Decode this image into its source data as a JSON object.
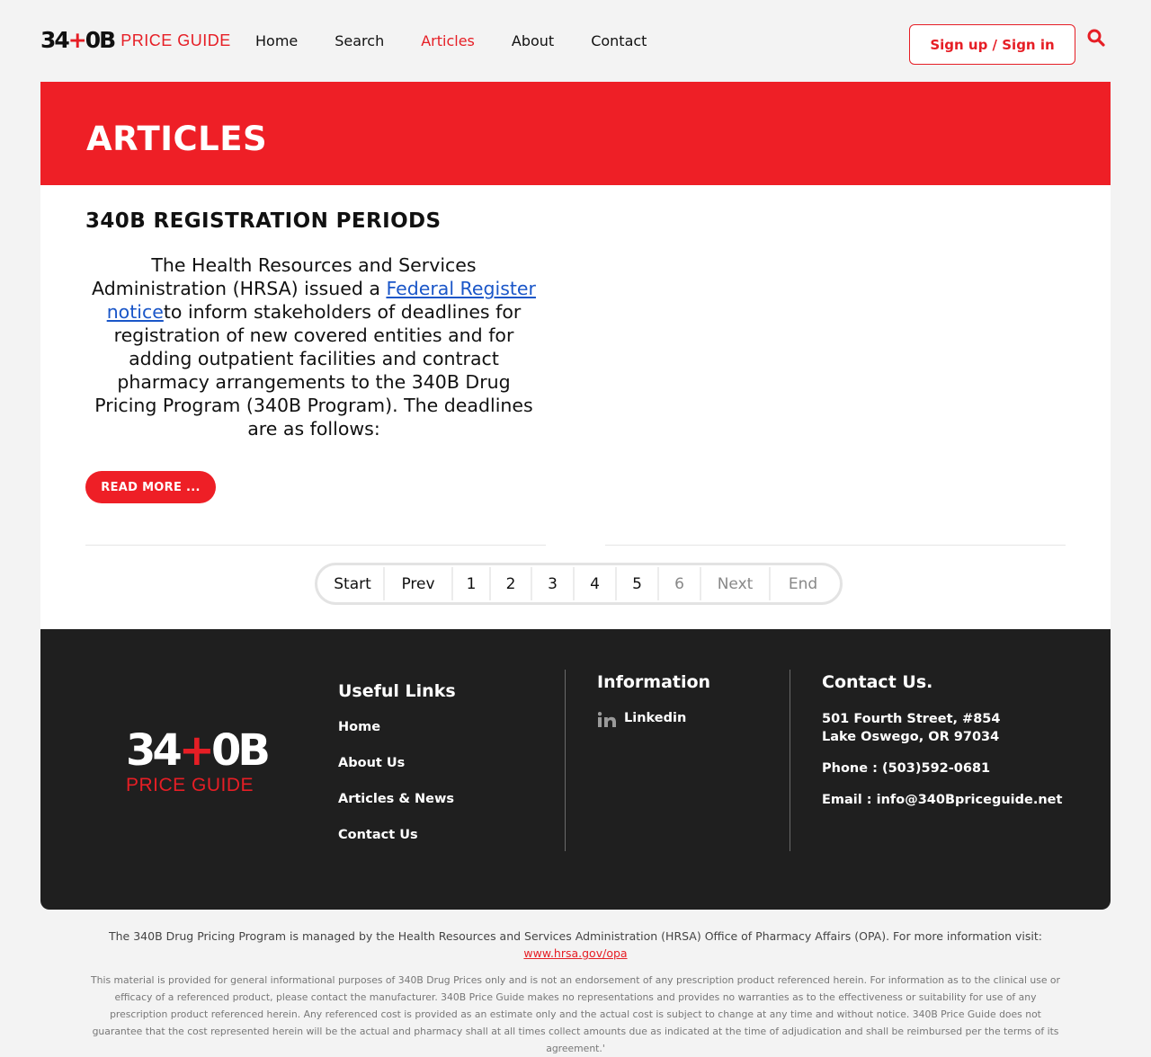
{
  "header": {
    "logo_mark_a": "34",
    "logo_mark_cross": "+",
    "logo_mark_b": "0B",
    "logo_text": "PRICE GUIDE",
    "nav": [
      "Home",
      "Search",
      "Articles",
      "About",
      "Contact"
    ],
    "active_nav": "Articles",
    "signin_label": "Sign up / Sign in",
    "accent_color": "#ee1f26"
  },
  "hero": {
    "title": "ARTICLES"
  },
  "article": {
    "title": "340B REGISTRATION PERIODS",
    "body_before_link": "The Health Resources and Services Administration (HRSA) issued a ",
    "link_text": "Federal Register notice",
    "body_after_link": "to inform stakeholders of deadlines for registration of new covered entities and for adding outpatient facilities and contract pharmacy arrangements to the 340B Drug Pricing Program (340B Program). The deadlines are as follows:",
    "read_more_label": "READ MORE ..."
  },
  "pagination": {
    "items": [
      "Start",
      "Prev",
      "1",
      "2",
      "3",
      "4",
      "5",
      "6",
      "Next",
      "End"
    ],
    "current": "6"
  },
  "footer": {
    "logo_mark_a": "34",
    "logo_mark_cross": "+",
    "logo_mark_b": "0B",
    "logo_text": "PRICE GUIDE",
    "useful_links_title": "Useful Links",
    "useful_links": [
      "Home",
      "About Us",
      "Articles & News",
      "Contact Us"
    ],
    "information_title": "Information",
    "linkedin_label": "Linkedin",
    "contact_title": "Contact Us.",
    "address_line1": "501 Fourth Street, #854",
    "address_line2": "Lake Oswego, OR 97034",
    "phone": "Phone : (503)592-0681",
    "email": "Email : info@340Bpriceguide.net"
  },
  "bottom": {
    "program_note": "The 340B Drug Pricing Program is managed by the Health Resources and Services Administration (HRSA) Office of Pharmacy Affairs (OPA). For more information visit:",
    "program_link": "www.hrsa.gov/opa",
    "disclaimer": "This material is provided for general informational purposes of 340B Drug Prices only and is not an endorsement of any prescription product referenced herein. For information as to the clinical use or efficacy of a referenced product, please contact the manufacturer. 340B Price Guide makes no representations and provides no warranties as to the effectiveness or suitability for use of any prescription product referenced herein. Any referenced cost is provided as an estimate only and the actual cost is subject to change at any time and without notice. 340B Price Guide does not guarantee that the cost represented herein will be the actual and pharmacy shall at all times collect amounts due as indicated at the time of adjudication and shall be reimbursed per the terms of its agreement.'"
  }
}
